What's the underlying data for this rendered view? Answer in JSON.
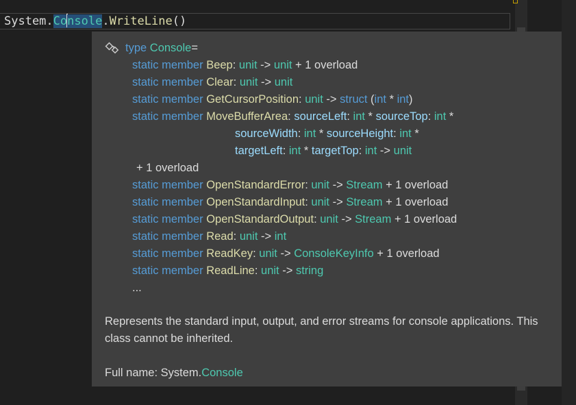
{
  "editor": {
    "code_prefix": "System.",
    "code_hl_a": "Co",
    "code_hl_b": "nsole",
    "code_dot": ".",
    "code_method": "WriteLine",
    "code_suffix": "()"
  },
  "tooltip": {
    "kw_type": "type",
    "type_name": "Console",
    "eq": " =",
    "kw_static": "static member",
    "arrow": " -> ",
    "star": " * ",
    "colon": ": ",
    "overload": "+ 1 overload",
    "ty_unit": "unit",
    "ty_int": "int",
    "ty_struct": "struct",
    "ty_stream": "Stream",
    "ty_string": "string",
    "ty_keyinfo": "ConsoleKeyInfo",
    "members": {
      "beep": "Beep",
      "clear": "Clear",
      "getpos": "GetCursorPosition",
      "move": "MoveBufferArea",
      "err": "OpenStandardError",
      "inp": "OpenStandardInput",
      "out": "OpenStandardOutput",
      "read": "Read",
      "readkey": "ReadKey",
      "readline": "ReadLine"
    },
    "params": {
      "sl": "sourceLeft",
      "st": "sourceTop",
      "sw": "sourceWidth",
      "sh": "sourceHeight",
      "tl": "targetLeft",
      "tt": "targetTop"
    },
    "ellipsis": "...",
    "description": "Represents the standard input, output, and error streams for console applications. This class cannot be inherited.",
    "fullname_label": "Full name: System.",
    "fullname_type": "Console"
  },
  "colors": {
    "keyword": "#569cd6",
    "type": "#4ec9b0",
    "member": "#dcdcaa",
    "param": "#9cdcfe",
    "tooltip_bg": "#3f3f3f"
  },
  "icons": {
    "class_icon": "class-icon"
  }
}
